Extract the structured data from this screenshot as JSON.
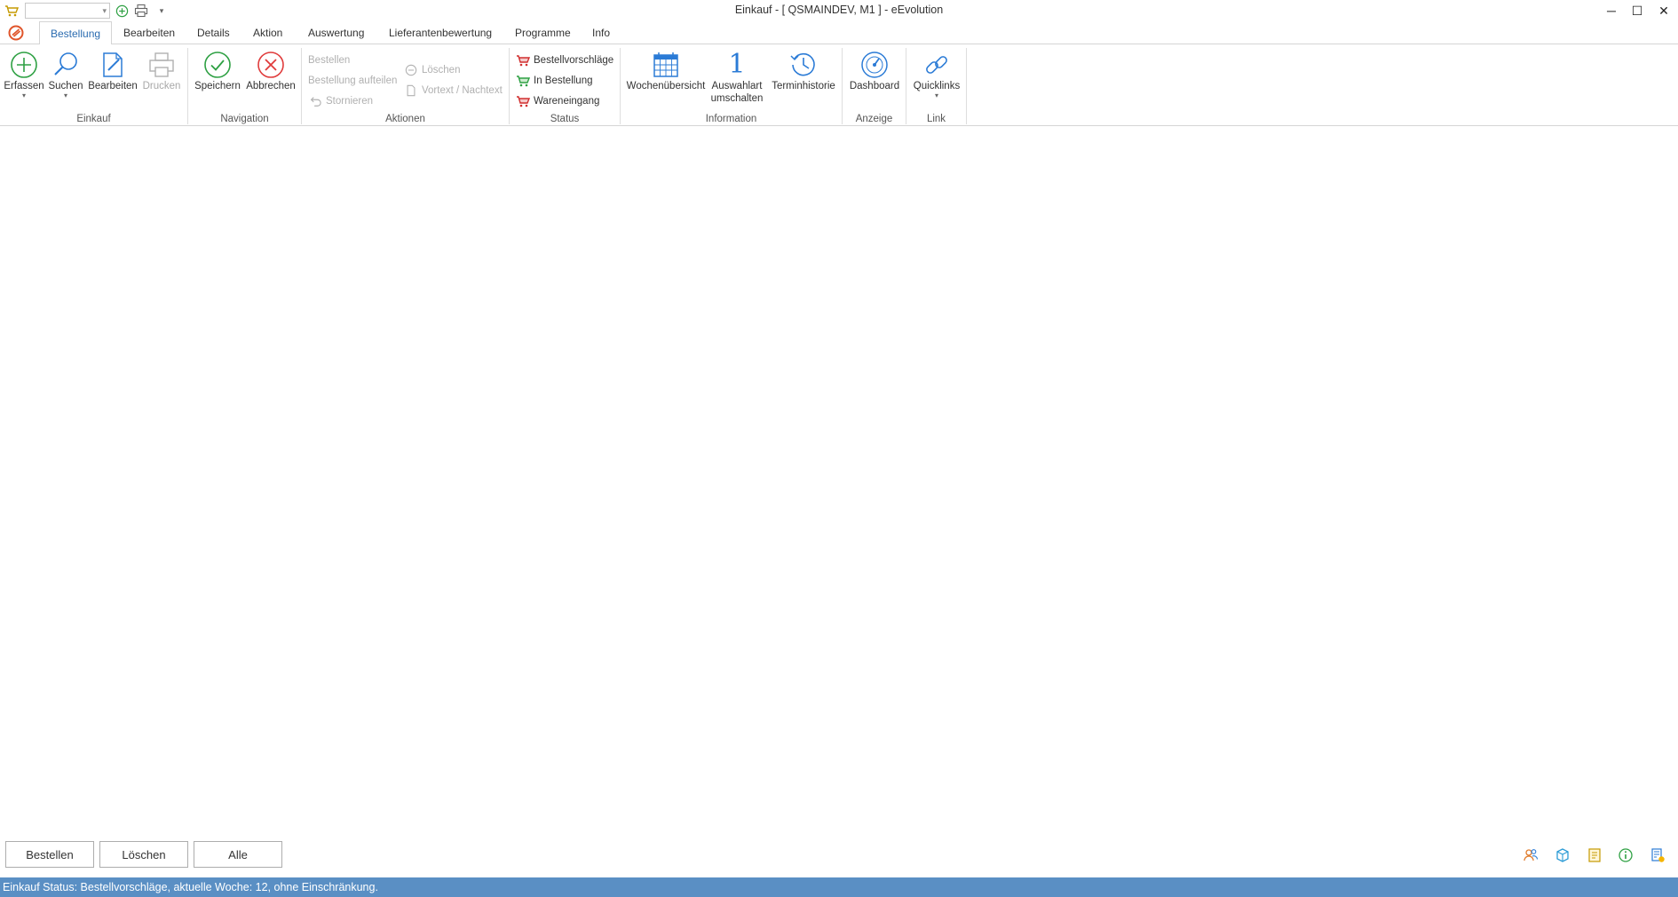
{
  "titlebar": {
    "title": "Einkauf - [ QSMAINDEV, M1 ]  -  eEvolution",
    "combo_value": "",
    "minimize": "─",
    "maximize": "☐",
    "close": "✕"
  },
  "tabs": [
    {
      "label": "Bestellung",
      "active": true
    },
    {
      "label": "Bearbeiten"
    },
    {
      "label": "Details"
    },
    {
      "label": "Aktion"
    },
    {
      "label": "Auswertung"
    },
    {
      "label": "Lieferantenbewertung"
    },
    {
      "label": "Programme"
    },
    {
      "label": "Info"
    }
  ],
  "ribbon": {
    "einkauf": {
      "label": "Einkauf",
      "erfassen": "Erfassen",
      "suchen": "Suchen",
      "bearbeiten": "Bearbeiten",
      "drucken": "Drucken"
    },
    "navigation": {
      "label": "Navigation",
      "speichern": "Speichern",
      "abbrechen": "Abbrechen"
    },
    "aktionen": {
      "label": "Aktionen",
      "bestellen": "Bestellen",
      "bestellung_aufteilen": "Bestellung aufteilen",
      "stornieren": "Stornieren",
      "loeschen": "Löschen",
      "vortext_nachtext": "Vortext / Nachtext"
    },
    "status": {
      "label": "Status",
      "bestellvorschlaege": "Bestellvorschläge",
      "in_bestellung": "In Bestellung",
      "wareneingang": "Wareneingang"
    },
    "information": {
      "label": "Information",
      "wochenuebersicht": "Wochenübersicht",
      "auswahlart_1": "Auswahlart",
      "auswahlart_2": "umschalten",
      "auswahlart_icon_text": "1",
      "terminhistorie": "Terminhistorie"
    },
    "anzeige": {
      "label": "Anzeige",
      "dashboard": "Dashboard"
    },
    "link": {
      "label": "Link",
      "quicklinks": "Quicklinks"
    }
  },
  "bottom_buttons": {
    "bestellen": "Bestellen",
    "loeschen": "Löschen",
    "alle": "Alle"
  },
  "statusbar": {
    "text": "Einkauf Status: Bestellvorschläge, aktuelle Woche: 12, ohne Einschränkung."
  },
  "colors": {
    "accent_blue": "#2b6cb0",
    "status_bar": "#5a8fc4",
    "green": "#2ea043",
    "red": "#e03b3b"
  }
}
